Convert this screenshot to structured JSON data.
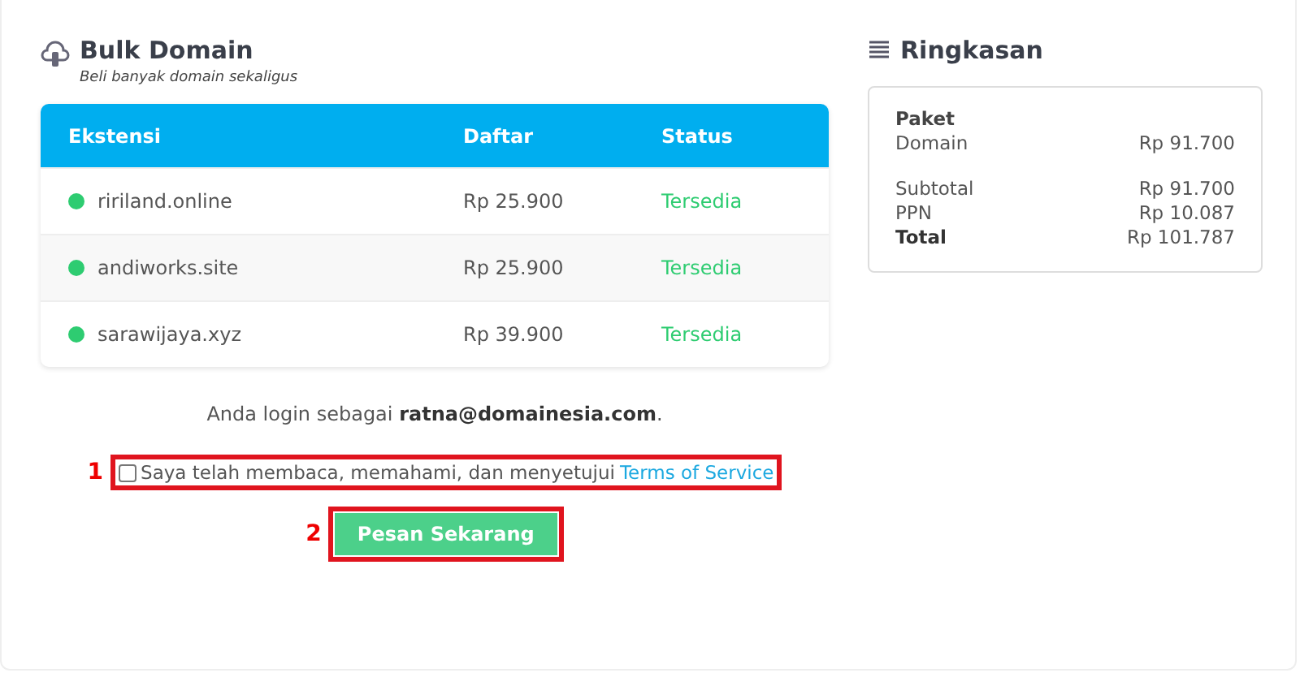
{
  "bulk": {
    "title": "Bulk Domain",
    "subtitle": "Beli banyak domain sekaligus",
    "columns": [
      "Ekstensi",
      "Daftar",
      "Status"
    ],
    "rows": [
      {
        "domain": "ririland.online",
        "price": "Rp 25.900",
        "status": "Tersedia",
        "color": "#2ecc71"
      },
      {
        "domain": "andiworks.site",
        "price": "Rp 25.900",
        "status": "Tersedia",
        "color": "#2ecc71"
      },
      {
        "domain": "sarawijaya.xyz",
        "price": "Rp 39.900",
        "status": "Tersedia",
        "color": "#2ecc71"
      }
    ]
  },
  "login": "Anda login sebagai **ratna@domainesia.com**.",
  "agreement": {
    "marker": "1",
    "checked": false,
    "text": "Saya telah membaca, memahami, dan menyetujui",
    "link": "Terms of Service"
  },
  "order": {
    "marker": "2",
    "label": "Pesan Sekarang"
  },
  "summary": {
    "title": "Ringkasan",
    "section": "Paket",
    "lines": [
      {
        "label": "Domain",
        "value": "Rp 91.700",
        "kind": "item"
      },
      {
        "label": "Subtotal",
        "value": "Rp 91.700",
        "kind": "gap"
      },
      {
        "label": "PPN",
        "value": "Rp 10.087",
        "kind": "item"
      },
      {
        "label": "Total",
        "value": "Rp 101.787",
        "kind": "total"
      }
    ]
  }
}
